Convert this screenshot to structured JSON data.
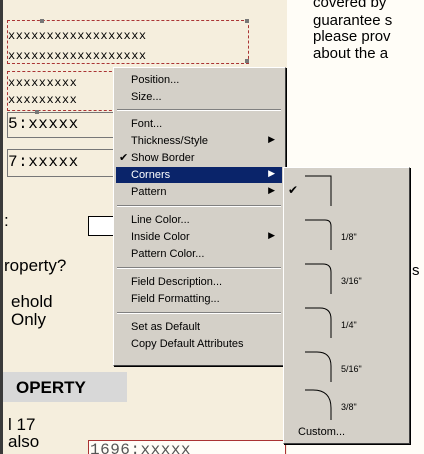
{
  "document": {
    "right_text": [
      "covered by",
      "guarantee s",
      "please prov",
      "about the a"
    ],
    "right_side_s": "s",
    "xlines": [
      "xxxxxxxxxxxxxxxxxx",
      "xxxxxxxxxxxxxxxxxx",
      "xxxxxxxxx",
      "xxxxxxxxx",
      "5:xxxxx",
      "7:xxxxx"
    ],
    "colon": ":",
    "roperty": "roperty?",
    "ehold": "ehold",
    "only": "Only",
    "section_header": "OPERTY",
    "line17": "l 17",
    "also": "also",
    "bottom_field": "1696:xxxxx"
  },
  "context_menu": {
    "items": [
      {
        "label": "Position...",
        "checked": false,
        "submenu": false
      },
      {
        "label": "Size...",
        "checked": false,
        "submenu": false
      },
      {
        "label": "Font...",
        "checked": false,
        "submenu": false
      },
      {
        "label": "Thickness/Style",
        "checked": false,
        "submenu": true
      },
      {
        "label": "Show Border",
        "checked": true,
        "submenu": false
      },
      {
        "label": "Corners",
        "checked": false,
        "submenu": true,
        "selected": true
      },
      {
        "label": "Pattern",
        "checked": false,
        "submenu": true
      },
      {
        "label": "Line Color...",
        "checked": false,
        "submenu": false
      },
      {
        "label": "Inside Color",
        "checked": false,
        "submenu": true
      },
      {
        "label": "Pattern Color...",
        "checked": false,
        "submenu": false
      },
      {
        "label": "Field Description...",
        "checked": false,
        "submenu": false
      },
      {
        "label": "Field Formatting...",
        "checked": false,
        "submenu": false
      },
      {
        "label": "Set as Default",
        "checked": false,
        "submenu": false
      },
      {
        "label": "Copy Default Attributes",
        "checked": false,
        "submenu": false
      }
    ],
    "check_glyph": "✔",
    "arrow_glyph": "▶"
  },
  "corners_submenu": {
    "options": [
      "",
      "1/8\"",
      "3/16\"",
      "1/4\"",
      "5/16\"",
      "3/8\""
    ],
    "selected_index": 0,
    "custom_label": "Custom..."
  },
  "colors": {
    "menu_bg": "#d4d0c8",
    "highlight": "#0a246a",
    "doc_bg": "#f5eedd"
  }
}
